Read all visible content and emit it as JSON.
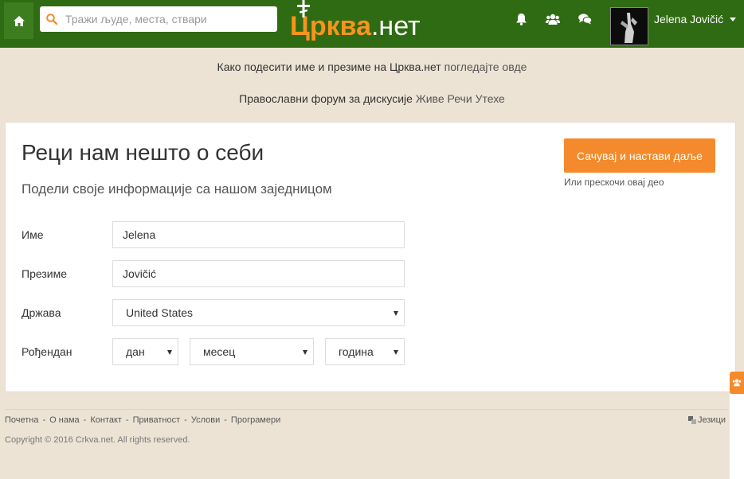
{
  "header": {
    "search_placeholder": "Тражи људе, места, ствари",
    "logo_main": "Црква",
    "logo_suffix": ".нет",
    "user_name": "Jelena Jovičić",
    "icons": [
      "home-icon",
      "search-icon",
      "bell-icon",
      "users-icon",
      "chat-icon"
    ]
  },
  "notices": {
    "line1_text": "Како подесити име и презиме на Црква.нет ",
    "line1_link": "погледајте овде",
    "line2_text": "Православни форум за дискусије ",
    "line2_link": "Живе Речи Утехе"
  },
  "card": {
    "title": "Реци нам нешто о себи",
    "subtitle": "Подели своје информације са нашом заједницом",
    "save_label": "Сачувај и настави даље",
    "skip_label": "Или прескочи овај део"
  },
  "form": {
    "first_name_label": "Име",
    "first_name_value": "Jelena",
    "last_name_label": "Презиме",
    "last_name_value": "Jovičić",
    "country_label": "Држава",
    "country_value": "United States",
    "birthday_label": "Рођендан",
    "day_value": "дан",
    "month_value": "месец",
    "year_value": "година"
  },
  "footer": {
    "links": [
      "Почетна",
      "О нама",
      "Контакт",
      "Приватност",
      "Услови",
      "Програмери"
    ],
    "separator": "-",
    "language": "Језици",
    "copyright": "Copyright © 2016 Crkva.net. All rights reserved."
  },
  "colors": {
    "topbar": "#2f6b12",
    "accent": "#f48a2b",
    "background": "#ede3d4"
  }
}
